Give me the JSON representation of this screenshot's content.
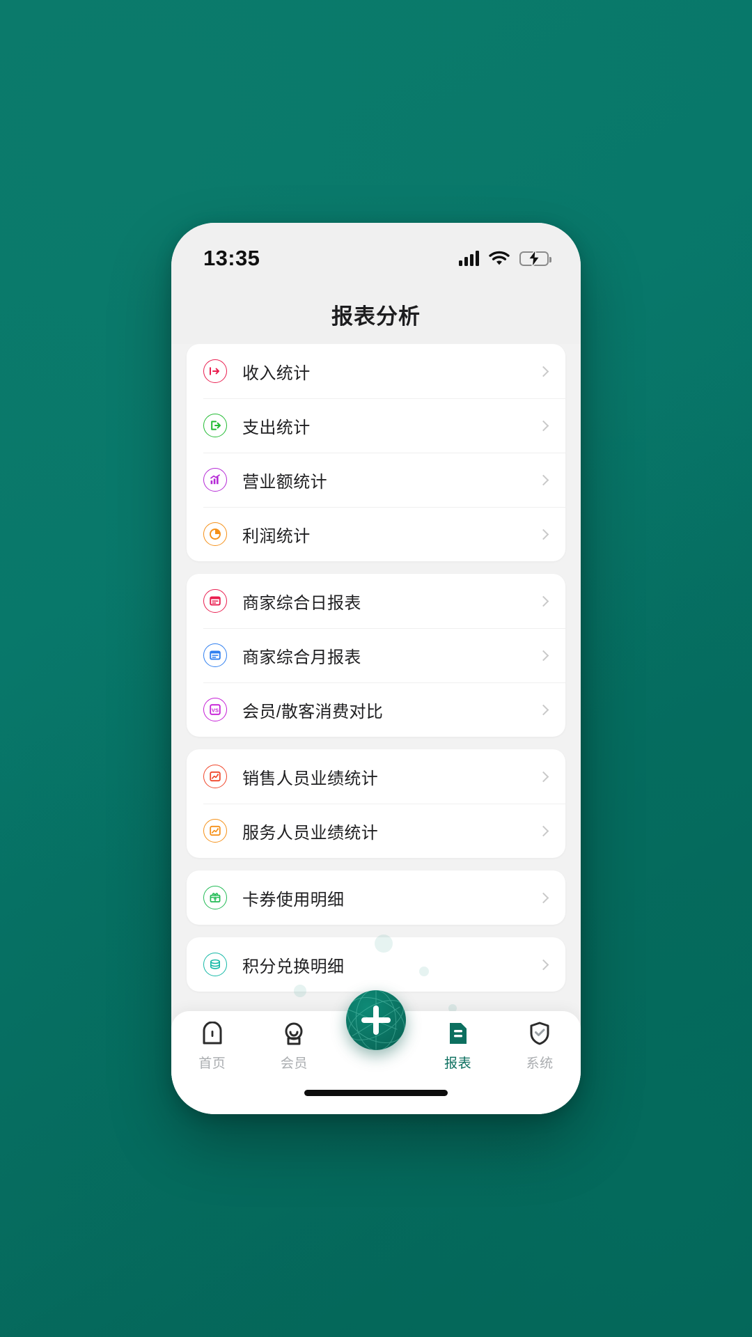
{
  "status_bar": {
    "time": "13:35",
    "signal_icon": "cellular-signal-icon",
    "wifi_icon": "wifi-icon",
    "battery_icon": "battery-charging-icon"
  },
  "header": {
    "title": "报表分析"
  },
  "colors": {
    "accent": "#0c6f5f",
    "page_bg": "#f2f2f2",
    "card_bg": "#ffffff",
    "chevron": "#c9c9c9",
    "inactive_tab": "#aaadb0"
  },
  "groups": [
    {
      "name": "statistics-group",
      "items": [
        {
          "label": "收入统计",
          "icon": "income-arrow-in-icon",
          "color": "#e91e4f"
        },
        {
          "label": "支出统计",
          "icon": "expense-arrow-out-icon",
          "color": "#22bb33"
        },
        {
          "label": "营业额统计",
          "icon": "bar-chart-trend-icon",
          "color": "#b52ad6"
        },
        {
          "label": "利润统计",
          "icon": "pie-chart-icon",
          "color": "#f59018"
        }
      ]
    },
    {
      "name": "merchant-reports-group",
      "items": [
        {
          "label": "商家综合日报表",
          "icon": "daily-report-icon",
          "color": "#e91e4f"
        },
        {
          "label": "商家综合月报表",
          "icon": "monthly-report-icon",
          "color": "#2f7ff0"
        },
        {
          "label": "会员/散客消费对比",
          "icon": "versus-compare-icon",
          "color": "#c51ed6"
        }
      ]
    },
    {
      "name": "staff-performance-group",
      "items": [
        {
          "label": "销售人员业绩统计",
          "icon": "sales-performance-icon",
          "color": "#f0462a"
        },
        {
          "label": "服务人员业绩统计",
          "icon": "service-performance-icon",
          "color": "#f59018"
        }
      ]
    },
    {
      "name": "coupon-group",
      "items": [
        {
          "label": "卡券使用明细",
          "icon": "coupon-gift-icon",
          "color": "#22bb55"
        }
      ]
    },
    {
      "name": "points-group",
      "items": [
        {
          "label": "积分兑换明细",
          "icon": "points-coins-icon",
          "color": "#14b8a6"
        }
      ]
    }
  ],
  "tab_bar": {
    "tabs": [
      {
        "label": "首页",
        "icon": "home-icon",
        "active": false
      },
      {
        "label": "会员",
        "icon": "member-icon",
        "active": false
      },
      {
        "label": "报表",
        "icon": "report-icon",
        "active": true
      },
      {
        "label": "系统",
        "icon": "shield-check-icon",
        "active": false
      }
    ],
    "fab": {
      "icon": "plus-icon",
      "label": ""
    }
  }
}
